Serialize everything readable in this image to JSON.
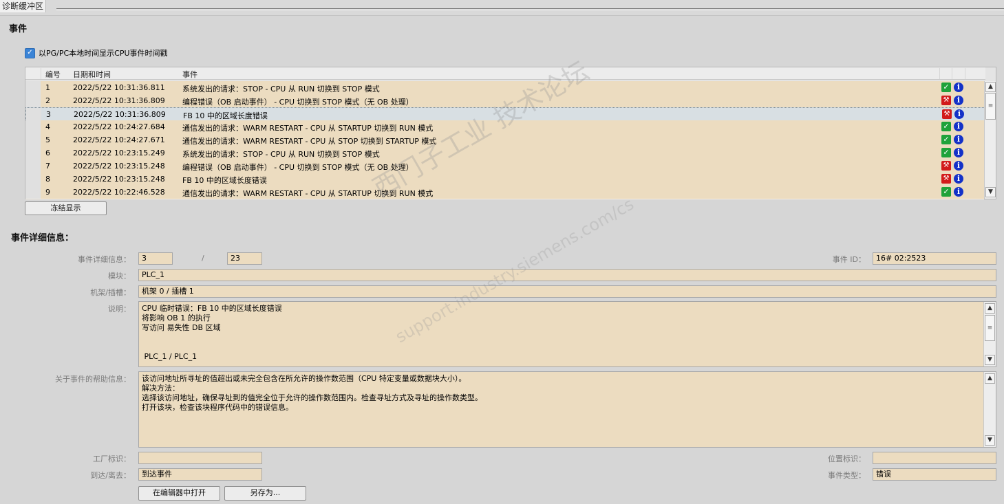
{
  "tab": {
    "title": "诊断缓冲区"
  },
  "events_section": {
    "title": "事件",
    "checkbox_label": "以PG/PC本地时间显示CPU事件时间戳",
    "checkbox_checked": true,
    "columns": {
      "no": "编号",
      "datetime": "日期和时间",
      "event": "事件"
    },
    "rows": [
      {
        "no": "1",
        "datetime": "2022/5/22 10:31:36.811",
        "event": "系统发出的请求：STOP - CPU 从 RUN 切换到 STOP 模式",
        "status_icon": "ok-check-icon"
      },
      {
        "no": "2",
        "datetime": "2022/5/22 10:31:36.809",
        "event": "编程错误（OB 启动事件） - CPU 切换到 STOP 模式（无 OB 处理）",
        "status_icon": "error-wrench-icon"
      },
      {
        "no": "3",
        "datetime": "2022/5/22 10:31:36.809",
        "event": "FB 10 中的区域长度错误",
        "status_icon": "error-wrench-icon",
        "selected": true
      },
      {
        "no": "4",
        "datetime": "2022/5/22 10:24:27.684",
        "event": "通信发出的请求：WARM RESTART - CPU 从 STARTUP 切换到 RUN 模式",
        "status_icon": "ok-check-icon"
      },
      {
        "no": "5",
        "datetime": "2022/5/22 10:24:27.671",
        "event": "通信发出的请求：WARM RESTART - CPU 从 STOP 切换到 STARTUP 模式",
        "status_icon": "ok-check-icon"
      },
      {
        "no": "6",
        "datetime": "2022/5/22 10:23:15.249",
        "event": "系统发出的请求：STOP - CPU 从 RUN 切换到 STOP 模式",
        "status_icon": "ok-check-icon"
      },
      {
        "no": "7",
        "datetime": "2022/5/22 10:23:15.248",
        "event": "编程错误（OB 启动事件） - CPU 切换到 STOP 模式（无 OB 处理）",
        "status_icon": "error-wrench-icon"
      },
      {
        "no": "8",
        "datetime": "2022/5/22 10:23:15.248",
        "event": "FB 10 中的区域长度错误",
        "status_icon": "error-wrench-icon"
      },
      {
        "no": "9",
        "datetime": "2022/5/22 10:22:46.528",
        "event": "通信发出的请求：WARM RESTART - CPU 从 STARTUP 切换到 RUN 模式",
        "status_icon": "ok-check-icon"
      }
    ],
    "freeze_button": "冻结显示"
  },
  "details": {
    "title": "事件详细信息：",
    "detail_label": "事件详细信息：",
    "detail_index": "3",
    "detail_separator": "/",
    "detail_total": "23",
    "event_id_label": "事件 ID：",
    "event_id": "16# 02:2523",
    "module_label": "模块：",
    "module": "PLC_1",
    "rack_label": "机架/插槽：",
    "rack": "机架 0 / 插槽 1",
    "description_label": "说明：",
    "description": "CPU 临时错误：FB 10 中的区域长度错误\n将影响 OB 1 的执行\n写访问 易失性 DB 区域\n\n\n PLC_1 / PLC_1",
    "help_label": "关于事件的帮助信息：",
    "help": "该访问地址所寻址的值超出或未完全包含在所允许的操作数范围（CPU 特定变量或数据块大小）。\n解决方法：\n选择该访问地址，确保寻址到的值完全位于允许的操作数范围内。检查寻址方式及寻址的操作数类型。\n打开该块，检查该块程序代码中的错误信息。",
    "plant_label": "工厂标识：",
    "plant": "",
    "location_label": "位置标识：",
    "location": "",
    "arrive_label": "到达/离去：",
    "arrive": "到达事件",
    "type_label": "事件类型：",
    "type": "错误",
    "open_editor_button": "在编辑器中打开",
    "save_as_button": "另存为..."
  },
  "watermark": {
    "line1": "西门子工业 技术论坛",
    "line2": "support.industry.siemens.com/cs"
  },
  "colors": {
    "field_bg": "#ecdcc0",
    "selected_row": "#d8dfe3",
    "ok": "#1fa23a",
    "error": "#d21b1b",
    "info": "#1432c8"
  }
}
